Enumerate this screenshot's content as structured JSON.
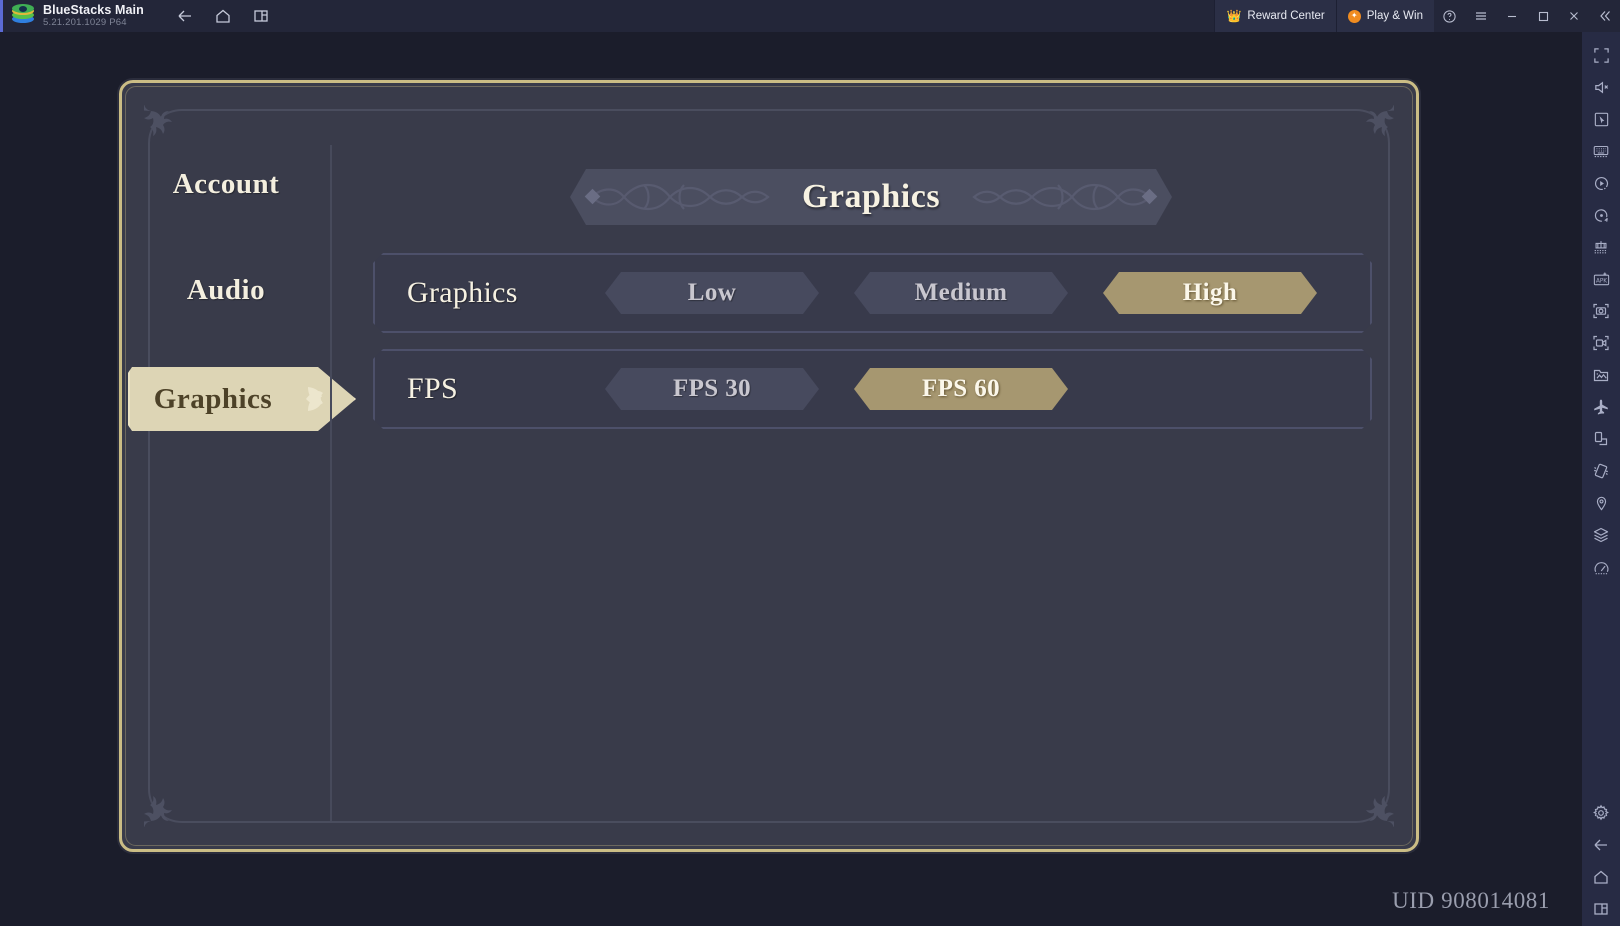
{
  "titlebar": {
    "app_name": "BlueStacks Main",
    "version": "5.21.201.1029  P64",
    "logo_icon": "bluestacks-logo",
    "nav": [
      {
        "icon": "back-arrow-icon",
        "name": "back-button"
      },
      {
        "icon": "home-icon",
        "name": "home-button"
      },
      {
        "icon": "multi-instance-icon",
        "name": "multi-instance-button"
      }
    ],
    "reward_center_label": "Reward Center",
    "reward_center_icon": "crown-icon",
    "play_win_label": "Play & Win",
    "play_win_icon": "orange-badge-icon",
    "help_icon": "question-circle-icon",
    "menu_icon": "hamburger-menu-icon",
    "minimize_icon": "minimize-icon",
    "maximize_icon": "maximize-icon",
    "close_icon": "close-icon",
    "collapse_icon": "double-chevron-left-icon"
  },
  "rightbar": {
    "items": [
      {
        "icon": "fullscreen-icon",
        "name": "fullscreen-button"
      },
      {
        "icon": "mute-icon",
        "name": "mute-button"
      },
      {
        "icon": "cursor-select-icon",
        "name": "cursor-control-button"
      },
      {
        "icon": "keyboard-icon",
        "name": "game-controls-button"
      },
      {
        "icon": "macro-play-icon",
        "name": "macro-recorder-button"
      },
      {
        "icon": "sync-icon",
        "name": "sync-operations-button"
      },
      {
        "icon": "multi-instance-sync-icon",
        "name": "instance-sync-button"
      },
      {
        "icon": "apk-install-icon",
        "name": "install-apk-button"
      },
      {
        "icon": "screenshot-icon",
        "name": "screenshot-button"
      },
      {
        "icon": "video-record-icon",
        "name": "screen-record-button"
      },
      {
        "icon": "media-manager-icon",
        "name": "media-manager-button"
      },
      {
        "icon": "airplane-icon",
        "name": "eco-mode-button"
      },
      {
        "icon": "rotate-screen-icon",
        "name": "rotate-button"
      },
      {
        "icon": "shake-icon",
        "name": "shake-button"
      },
      {
        "icon": "location-pin-icon",
        "name": "location-button"
      },
      {
        "icon": "layers-icon",
        "name": "layers-button"
      },
      {
        "icon": "performance-meter-icon",
        "name": "performance-button"
      }
    ],
    "bottom_items": [
      {
        "icon": "gear-icon",
        "name": "settings-button"
      },
      {
        "icon": "back-arrow-icon",
        "name": "android-back-button"
      },
      {
        "icon": "home-icon",
        "name": "android-home-button"
      },
      {
        "icon": "recents-icon",
        "name": "android-recents-button"
      }
    ]
  },
  "game": {
    "banner_title": "Graphics",
    "tabs": [
      {
        "label": "Account",
        "active": false
      },
      {
        "label": "Audio",
        "active": false
      },
      {
        "label": "Graphics",
        "active": true
      }
    ],
    "rows": [
      {
        "label": "Graphics",
        "options": [
          {
            "label": "Low",
            "selected": false
          },
          {
            "label": "Medium",
            "selected": false
          },
          {
            "label": "High",
            "selected": true
          }
        ]
      },
      {
        "label": "FPS",
        "options": [
          {
            "label": "FPS 30",
            "selected": false
          },
          {
            "label": "FPS 60",
            "selected": true
          }
        ]
      }
    ],
    "uid": "UID 908014081"
  },
  "colors": {
    "panel_bg": "#393b4a",
    "panel_border_gold": "#cbbd85",
    "selected_gold": "#a69770",
    "active_tab_cream": "#ddd5b5",
    "text_cream": "#f6f1e2",
    "titlebar_bg": "#232639",
    "rightbar_bg": "#272b44",
    "accent_blue": "#5b6bd6"
  }
}
